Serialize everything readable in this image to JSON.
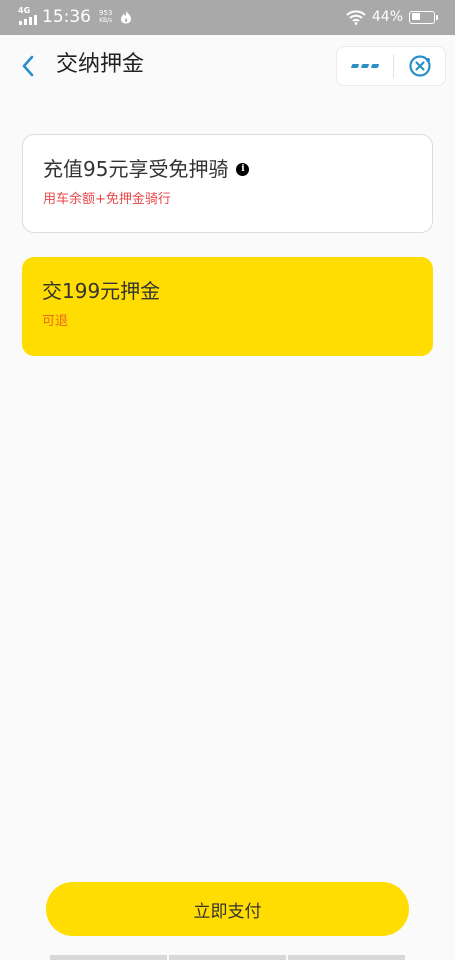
{
  "status_bar": {
    "network": "4G",
    "time": "15:36",
    "net_speed_value": "953",
    "net_speed_unit": "KB/s",
    "battery_percent_text": "44%",
    "battery_level": 0.44
  },
  "nav": {
    "title": "交纳押金"
  },
  "options": {
    "free_deposit": {
      "title": "充值95元享受免押骑",
      "subtitle": "用车余额+免押金骑行"
    },
    "pay_deposit": {
      "title": "交199元押金",
      "subtitle": "可退"
    }
  },
  "pay_button_label": "立即支付",
  "colors": {
    "accent_yellow": "#ffdd00",
    "subtitle_red": "#e8484a",
    "subtitle_orange": "#e86a1a",
    "icon_blue": "#2a8fc9"
  },
  "icons": {
    "back": "chevron-left-icon",
    "more": "more-dots-icon",
    "close": "close-target-icon",
    "info": "info-icon"
  }
}
